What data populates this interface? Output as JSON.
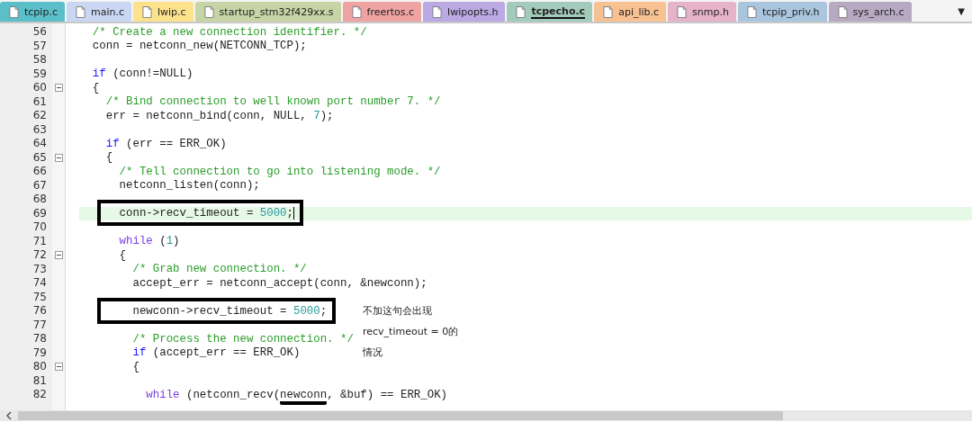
{
  "tabs": [
    {
      "label": "tcpip.c",
      "color": "#5bbfc9",
      "selected": false
    },
    {
      "label": "main.c",
      "color": "#c9d7f2",
      "selected": false
    },
    {
      "label": "lwip.c",
      "color": "#fde28c",
      "selected": false
    },
    {
      "label": "startup_stm32f429xx.s",
      "color": "#c6d4a6",
      "selected": false
    },
    {
      "label": "freertos.c",
      "color": "#f0a3a3",
      "selected": false
    },
    {
      "label": "lwipopts.h",
      "color": "#bba9e3",
      "selected": false
    },
    {
      "label": "tcpecho.c",
      "color": "#a3cbbb",
      "selected": true
    },
    {
      "label": "api_lib.c",
      "color": "#f7c192",
      "selected": false
    },
    {
      "label": "snmp.h",
      "color": "#e6b3c9",
      "selected": false
    },
    {
      "label": "tcpip_priv.h",
      "color": "#a9c6de",
      "selected": false
    },
    {
      "label": "sys_arch.c",
      "color": "#b7a9c2",
      "selected": false
    }
  ],
  "tab_menu": "▼",
  "editor": {
    "lines": [
      {
        "number": "56",
        "fold": false,
        "current": false,
        "boxed": false,
        "segments": [
          {
            "kind": "comment",
            "text": "  /* Create a new connection identifier. */"
          }
        ]
      },
      {
        "number": "57",
        "fold": false,
        "current": false,
        "boxed": false,
        "segments": [
          {
            "kind": "code",
            "text": "  conn = netconn_new(NETCONN_TCP);"
          }
        ]
      },
      {
        "number": "58",
        "fold": false,
        "current": false,
        "boxed": false
      },
      {
        "number": "59",
        "fold": false,
        "current": false,
        "boxed": false,
        "segments": [
          {
            "kind": "keyword",
            "text": "  if"
          },
          {
            "kind": "code",
            "text": " (conn!=NULL)"
          }
        ]
      },
      {
        "number": "60",
        "fold": true,
        "current": false,
        "boxed": false,
        "segments": [
          {
            "kind": "code",
            "text": "  {"
          }
        ]
      },
      {
        "number": "61",
        "fold": false,
        "current": false,
        "boxed": false,
        "segments": [
          {
            "kind": "comment",
            "text": "    /* Bind connection to well known port number 7. */"
          }
        ]
      },
      {
        "number": "62",
        "fold": false,
        "current": false,
        "boxed": false,
        "segments": [
          {
            "kind": "code",
            "text": "    err = netconn_bind(conn, NULL, "
          },
          {
            "kind": "number",
            "text": "7"
          },
          {
            "kind": "code",
            "text": ");"
          }
        ]
      },
      {
        "number": "63",
        "fold": false,
        "current": false,
        "boxed": false
      },
      {
        "number": "64",
        "fold": false,
        "current": false,
        "boxed": false,
        "segments": [
          {
            "kind": "keyword",
            "text": "    if"
          },
          {
            "kind": "code",
            "text": " (err == ERR_OK)"
          }
        ]
      },
      {
        "number": "65",
        "fold": true,
        "current": false,
        "boxed": false,
        "segments": [
          {
            "kind": "code",
            "text": "    {"
          }
        ]
      },
      {
        "number": "66",
        "fold": false,
        "current": false,
        "boxed": false,
        "segments": [
          {
            "kind": "comment",
            "text": "      /* Tell connection to go into listening mode. */"
          }
        ]
      },
      {
        "number": "67",
        "fold": false,
        "current": false,
        "boxed": false,
        "segments": [
          {
            "kind": "code",
            "text": "      netconn_listen(conn);"
          }
        ]
      },
      {
        "number": "68",
        "fold": false,
        "current": false,
        "boxed": false
      },
      {
        "number": "69",
        "fold": false,
        "current": true,
        "boxed": true,
        "segments": [
          {
            "kind": "code",
            "text": "      conn->recv_timeout = "
          },
          {
            "kind": "number",
            "text": "5000"
          },
          {
            "kind": "code",
            "text": ";"
          }
        ]
      },
      {
        "number": "70",
        "fold": false,
        "current": false,
        "boxed": false
      },
      {
        "number": "71",
        "fold": false,
        "current": false,
        "boxed": false,
        "segments": [
          {
            "kind": "loop",
            "text": "      while"
          },
          {
            "kind": "code",
            "text": " ("
          },
          {
            "kind": "number",
            "text": "1"
          },
          {
            "kind": "code",
            "text": ")"
          }
        ]
      },
      {
        "number": "72",
        "fold": true,
        "current": false,
        "boxed": false,
        "segments": [
          {
            "kind": "code",
            "text": "      {"
          }
        ]
      },
      {
        "number": "73",
        "fold": false,
        "current": false,
        "boxed": false,
        "segments": [
          {
            "kind": "comment",
            "text": "        /* Grab new connection. */"
          }
        ]
      },
      {
        "number": "74",
        "fold": false,
        "current": false,
        "boxed": false,
        "segments": [
          {
            "kind": "code",
            "text": "        accept_err = netconn_accept(conn, &newconn);"
          }
        ]
      },
      {
        "number": "75",
        "fold": false,
        "current": false,
        "boxed": false
      },
      {
        "number": "76",
        "fold": false,
        "current": false,
        "boxed": true,
        "segments": [
          {
            "kind": "code",
            "text": "        newconn->recv_timeout = "
          },
          {
            "kind": "number",
            "text": "5000"
          },
          {
            "kind": "code",
            "text": ";"
          }
        ]
      },
      {
        "number": "77",
        "fold": false,
        "current": false,
        "boxed": false
      },
      {
        "number": "78",
        "fold": false,
        "current": false,
        "boxed": false,
        "segments": [
          {
            "kind": "comment",
            "text": "        /* Process the new connection. */"
          }
        ]
      },
      {
        "number": "79",
        "fold": false,
        "current": false,
        "boxed": false,
        "segments": [
          {
            "kind": "keyword",
            "text": "        if"
          },
          {
            "kind": "code",
            "text": " (accept_err == ERR_OK)"
          }
        ]
      },
      {
        "number": "80",
        "fold": true,
        "current": false,
        "boxed": false,
        "segments": [
          {
            "kind": "code",
            "text": "        {"
          }
        ]
      },
      {
        "number": "81",
        "fold": false,
        "current": false,
        "boxed": false
      },
      {
        "number": "82",
        "fold": false,
        "current": false,
        "boxed": false,
        "segments": [
          {
            "kind": "loop",
            "text": "          while"
          },
          {
            "kind": "code",
            "text": " (netconn_recv("
          },
          {
            "kind": "code",
            "text": "newconn",
            "underlined": true
          },
          {
            "kind": "code",
            "text": ", &buf) == ERR_OK)"
          }
        ]
      }
    ]
  },
  "note": [
    "不加这句会出现",
    "recv_timeout = 0的",
    "情况"
  ]
}
